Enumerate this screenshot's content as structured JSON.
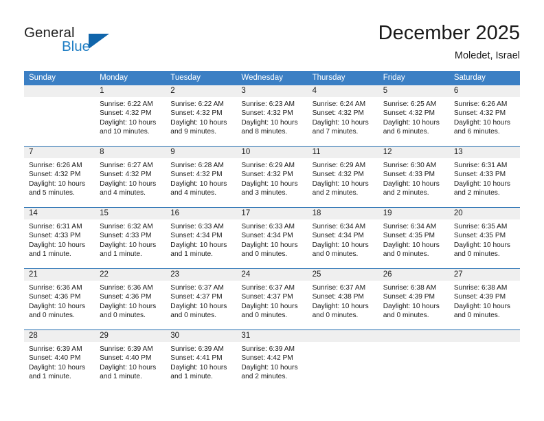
{
  "brand": {
    "name_part1": "General",
    "name_part2": "Blue",
    "accent_color": "#1065ab",
    "blue_text_color": "#1f7ec4"
  },
  "header": {
    "title": "December 2025",
    "subtitle": "Moledet, Israel"
  },
  "calendar": {
    "header_bg": "#3b7fc4",
    "row_divider_color": "#1f6cb0",
    "daynum_bar_color": "#efefef",
    "day_names": [
      "Sunday",
      "Monday",
      "Tuesday",
      "Wednesday",
      "Thursday",
      "Friday",
      "Saturday"
    ],
    "weeks": [
      [
        {
          "day": "",
          "lines": []
        },
        {
          "day": "1",
          "lines": [
            "Sunrise: 6:22 AM",
            "Sunset: 4:32 PM",
            "Daylight: 10 hours",
            "and 10 minutes."
          ]
        },
        {
          "day": "2",
          "lines": [
            "Sunrise: 6:22 AM",
            "Sunset: 4:32 PM",
            "Daylight: 10 hours",
            "and 9 minutes."
          ]
        },
        {
          "day": "3",
          "lines": [
            "Sunrise: 6:23 AM",
            "Sunset: 4:32 PM",
            "Daylight: 10 hours",
            "and 8 minutes."
          ]
        },
        {
          "day": "4",
          "lines": [
            "Sunrise: 6:24 AM",
            "Sunset: 4:32 PM",
            "Daylight: 10 hours",
            "and 7 minutes."
          ]
        },
        {
          "day": "5",
          "lines": [
            "Sunrise: 6:25 AM",
            "Sunset: 4:32 PM",
            "Daylight: 10 hours",
            "and 6 minutes."
          ]
        },
        {
          "day": "6",
          "lines": [
            "Sunrise: 6:26 AM",
            "Sunset: 4:32 PM",
            "Daylight: 10 hours",
            "and 6 minutes."
          ]
        }
      ],
      [
        {
          "day": "7",
          "lines": [
            "Sunrise: 6:26 AM",
            "Sunset: 4:32 PM",
            "Daylight: 10 hours",
            "and 5 minutes."
          ]
        },
        {
          "day": "8",
          "lines": [
            "Sunrise: 6:27 AM",
            "Sunset: 4:32 PM",
            "Daylight: 10 hours",
            "and 4 minutes."
          ]
        },
        {
          "day": "9",
          "lines": [
            "Sunrise: 6:28 AM",
            "Sunset: 4:32 PM",
            "Daylight: 10 hours",
            "and 4 minutes."
          ]
        },
        {
          "day": "10",
          "lines": [
            "Sunrise: 6:29 AM",
            "Sunset: 4:32 PM",
            "Daylight: 10 hours",
            "and 3 minutes."
          ]
        },
        {
          "day": "11",
          "lines": [
            "Sunrise: 6:29 AM",
            "Sunset: 4:32 PM",
            "Daylight: 10 hours",
            "and 2 minutes."
          ]
        },
        {
          "day": "12",
          "lines": [
            "Sunrise: 6:30 AM",
            "Sunset: 4:33 PM",
            "Daylight: 10 hours",
            "and 2 minutes."
          ]
        },
        {
          "day": "13",
          "lines": [
            "Sunrise: 6:31 AM",
            "Sunset: 4:33 PM",
            "Daylight: 10 hours",
            "and 2 minutes."
          ]
        }
      ],
      [
        {
          "day": "14",
          "lines": [
            "Sunrise: 6:31 AM",
            "Sunset: 4:33 PM",
            "Daylight: 10 hours",
            "and 1 minute."
          ]
        },
        {
          "day": "15",
          "lines": [
            "Sunrise: 6:32 AM",
            "Sunset: 4:33 PM",
            "Daylight: 10 hours",
            "and 1 minute."
          ]
        },
        {
          "day": "16",
          "lines": [
            "Sunrise: 6:33 AM",
            "Sunset: 4:34 PM",
            "Daylight: 10 hours",
            "and 1 minute."
          ]
        },
        {
          "day": "17",
          "lines": [
            "Sunrise: 6:33 AM",
            "Sunset: 4:34 PM",
            "Daylight: 10 hours",
            "and 0 minutes."
          ]
        },
        {
          "day": "18",
          "lines": [
            "Sunrise: 6:34 AM",
            "Sunset: 4:34 PM",
            "Daylight: 10 hours",
            "and 0 minutes."
          ]
        },
        {
          "day": "19",
          "lines": [
            "Sunrise: 6:34 AM",
            "Sunset: 4:35 PM",
            "Daylight: 10 hours",
            "and 0 minutes."
          ]
        },
        {
          "day": "20",
          "lines": [
            "Sunrise: 6:35 AM",
            "Sunset: 4:35 PM",
            "Daylight: 10 hours",
            "and 0 minutes."
          ]
        }
      ],
      [
        {
          "day": "21",
          "lines": [
            "Sunrise: 6:36 AM",
            "Sunset: 4:36 PM",
            "Daylight: 10 hours",
            "and 0 minutes."
          ]
        },
        {
          "day": "22",
          "lines": [
            "Sunrise: 6:36 AM",
            "Sunset: 4:36 PM",
            "Daylight: 10 hours",
            "and 0 minutes."
          ]
        },
        {
          "day": "23",
          "lines": [
            "Sunrise: 6:37 AM",
            "Sunset: 4:37 PM",
            "Daylight: 10 hours",
            "and 0 minutes."
          ]
        },
        {
          "day": "24",
          "lines": [
            "Sunrise: 6:37 AM",
            "Sunset: 4:37 PM",
            "Daylight: 10 hours",
            "and 0 minutes."
          ]
        },
        {
          "day": "25",
          "lines": [
            "Sunrise: 6:37 AM",
            "Sunset: 4:38 PM",
            "Daylight: 10 hours",
            "and 0 minutes."
          ]
        },
        {
          "day": "26",
          "lines": [
            "Sunrise: 6:38 AM",
            "Sunset: 4:39 PM",
            "Daylight: 10 hours",
            "and 0 minutes."
          ]
        },
        {
          "day": "27",
          "lines": [
            "Sunrise: 6:38 AM",
            "Sunset: 4:39 PM",
            "Daylight: 10 hours",
            "and 0 minutes."
          ]
        }
      ],
      [
        {
          "day": "28",
          "lines": [
            "Sunrise: 6:39 AM",
            "Sunset: 4:40 PM",
            "Daylight: 10 hours",
            "and 1 minute."
          ]
        },
        {
          "day": "29",
          "lines": [
            "Sunrise: 6:39 AM",
            "Sunset: 4:40 PM",
            "Daylight: 10 hours",
            "and 1 minute."
          ]
        },
        {
          "day": "30",
          "lines": [
            "Sunrise: 6:39 AM",
            "Sunset: 4:41 PM",
            "Daylight: 10 hours",
            "and 1 minute."
          ]
        },
        {
          "day": "31",
          "lines": [
            "Sunrise: 6:39 AM",
            "Sunset: 4:42 PM",
            "Daylight: 10 hours",
            "and 2 minutes."
          ]
        },
        {
          "day": "",
          "lines": []
        },
        {
          "day": "",
          "lines": []
        },
        {
          "day": "",
          "lines": []
        }
      ]
    ]
  }
}
